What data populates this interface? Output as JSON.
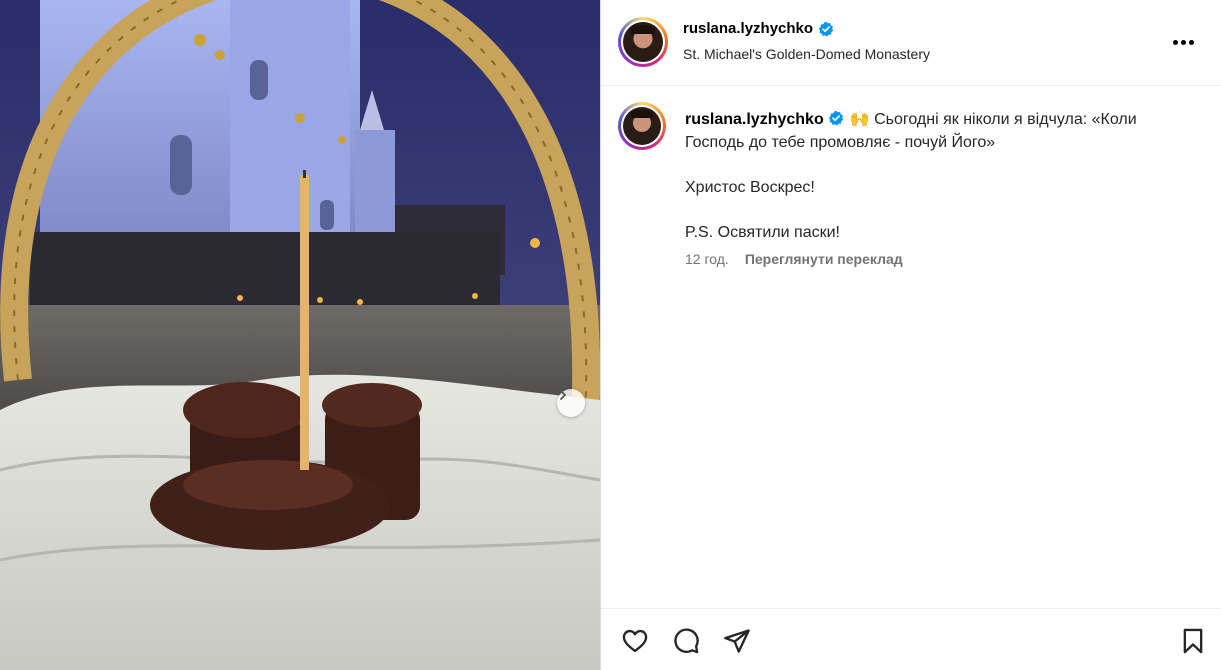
{
  "post": {
    "author": "ruslana.lyzhychko",
    "location": "St. Michael's Golden-Domed Monastery",
    "caption_lines": [
      "🙌 Сьогодні як ніколи я відчула: «Коли Господь до тебе промовляє - почуй Його»",
      "Христос Воскрес!",
      "P.S. Освятили паски!"
    ],
    "time_ago": "12 год.",
    "translate_label": "Переглянути переклад"
  },
  "icons": {
    "verified": "verified-badge-icon",
    "more": "more-options-icon",
    "like": "heart-icon",
    "comment": "comment-bubble-icon",
    "share": "paper-plane-icon",
    "save": "bookmark-icon",
    "next": "chevron-right-icon"
  },
  "colors": {
    "verified": "#0095f6",
    "text": "#262626",
    "secondary": "#737373",
    "divider": "#efefef"
  }
}
